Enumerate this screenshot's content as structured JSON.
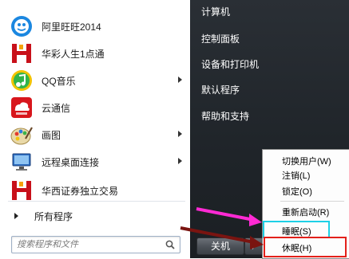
{
  "programs": [
    {
      "label": "阿里旺旺2014",
      "icon": "aliwangwang-icon",
      "has_submenu": false
    },
    {
      "label": "华彩人生1点通",
      "icon": "huacai-icon",
      "has_submenu": false
    },
    {
      "label": "QQ音乐",
      "icon": "qq-music-icon",
      "has_submenu": true
    },
    {
      "label": "云通信",
      "icon": "cloud-telecom-icon",
      "has_submenu": false
    },
    {
      "label": "画图",
      "icon": "paint-icon",
      "has_submenu": true
    },
    {
      "label": "远程桌面连接",
      "icon": "remote-desktop-icon",
      "has_submenu": true
    },
    {
      "label": "华西证券独立交易",
      "icon": "huaxi-securities-icon",
      "has_submenu": false
    }
  ],
  "all_programs_label": "所有程序",
  "search": {
    "placeholder": "搜索程序和文件"
  },
  "right_pane": {
    "items": [
      "计算机",
      "控制面板",
      "设备和打印机",
      "默认程序",
      "帮助和支持"
    ]
  },
  "shutdown": {
    "label": "关机"
  },
  "power_menu": {
    "items": [
      "切换用户(W)",
      "注销(L)",
      "锁定(O)",
      "重新启动(R)",
      "睡眠(S)",
      "休眠(H)"
    ]
  },
  "colors": {
    "sleep_highlight": "#1ed0e6",
    "hibernate_highlight": "#e3201a",
    "pink_arrow": "#ff2ad4",
    "maroon_arrow": "#7a1410"
  }
}
